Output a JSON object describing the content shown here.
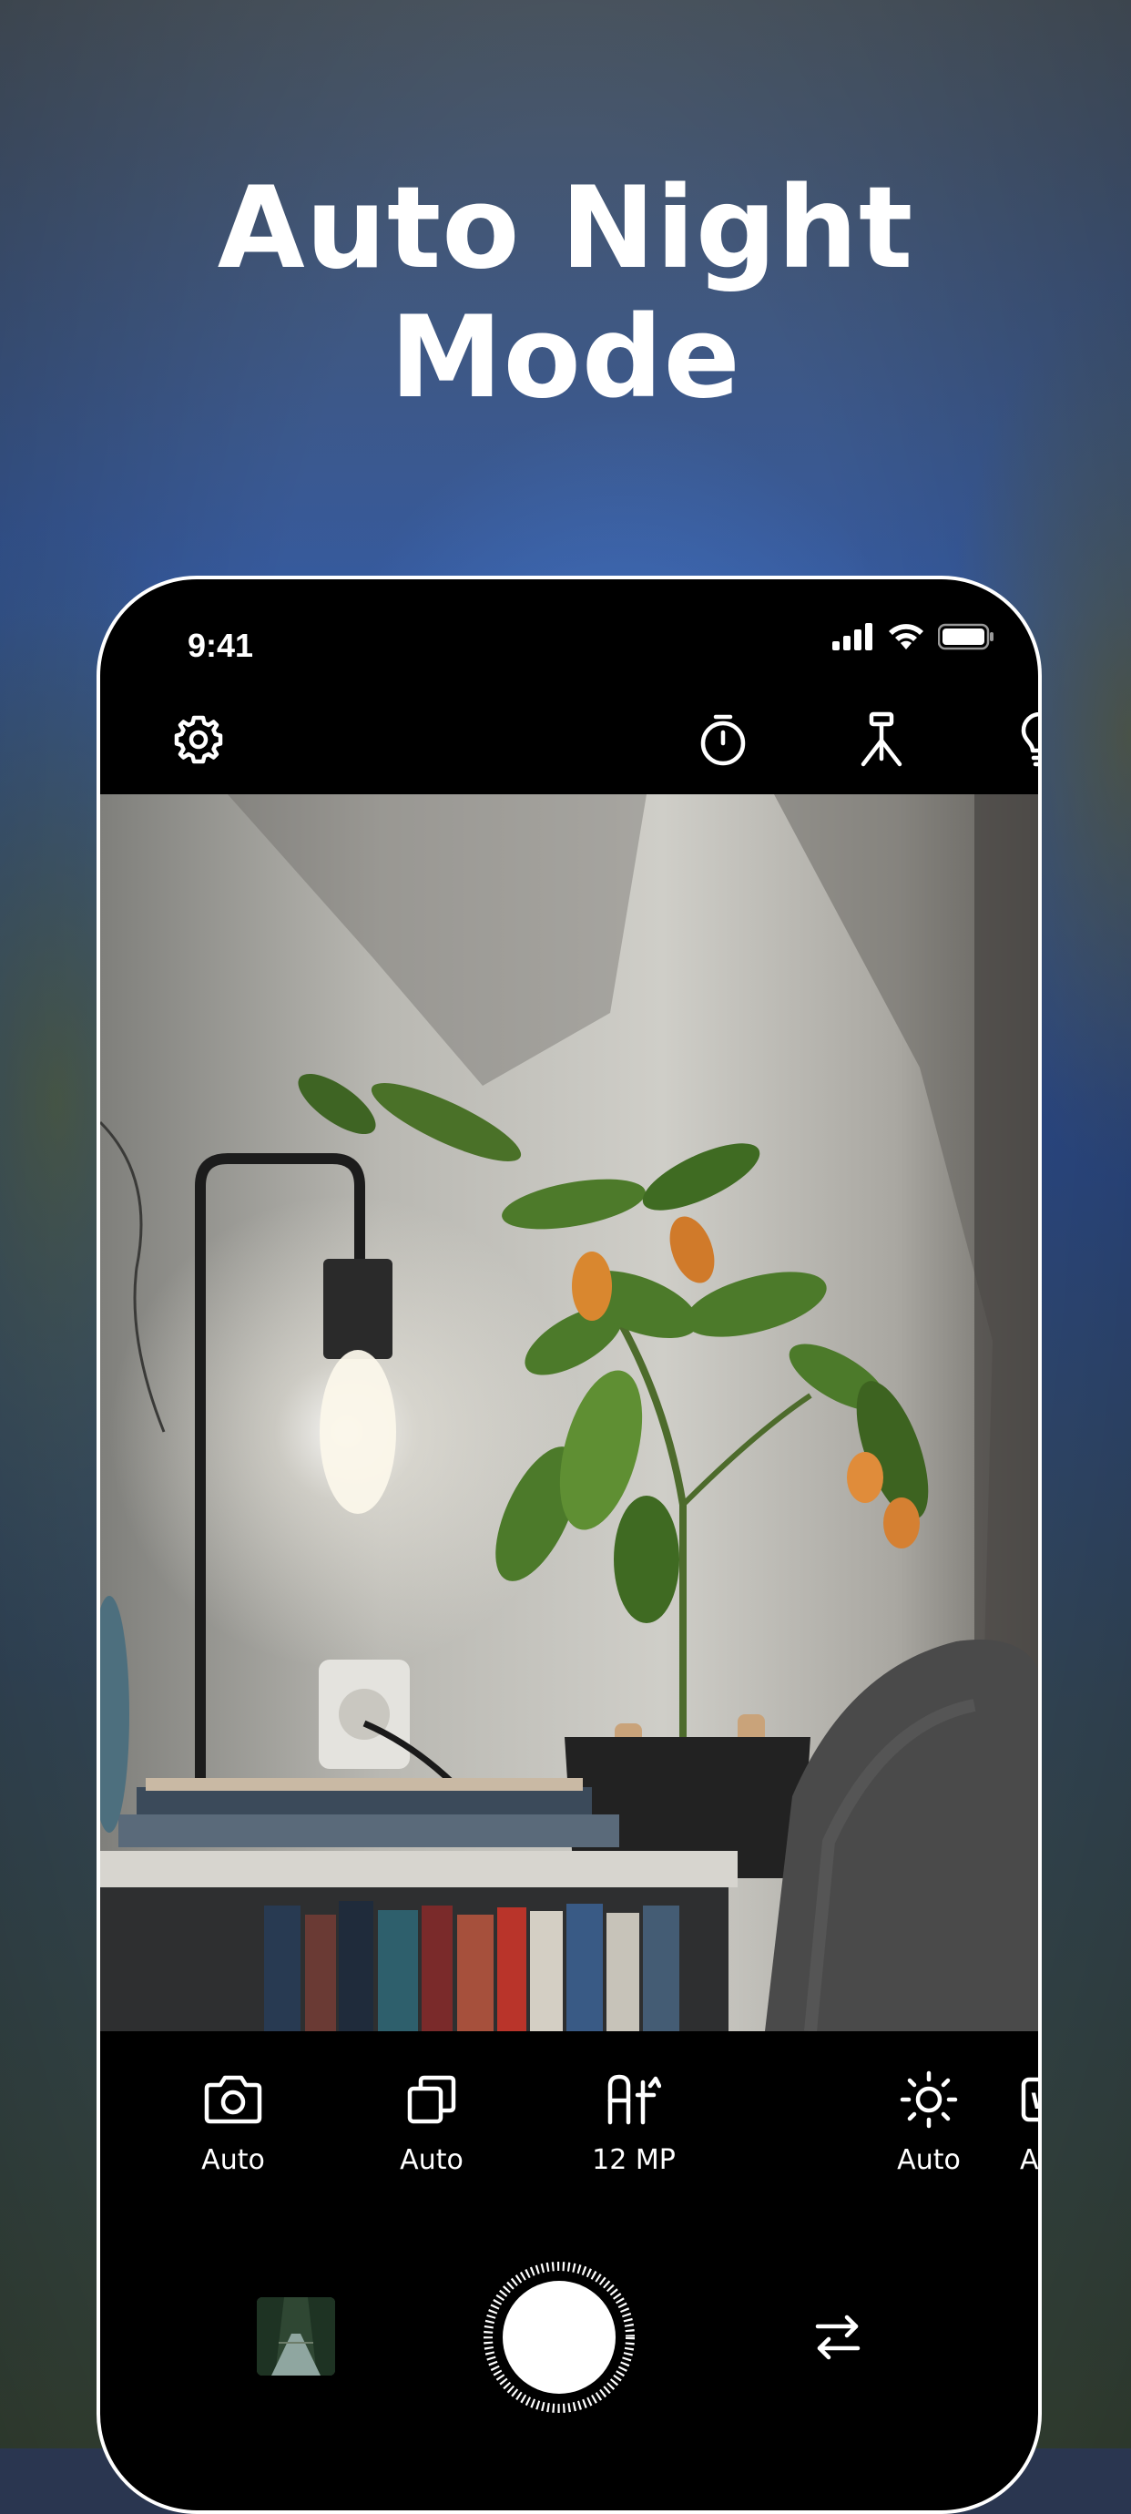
{
  "headline": {
    "line1": "Auto Night",
    "line2": "Mode"
  },
  "status_bar": {
    "time": "9:41",
    "icons": [
      "cellular-signal-icon",
      "wifi-icon",
      "battery-icon"
    ]
  },
  "toolbar": {
    "icons": [
      "settings-gear-icon",
      "timer-icon",
      "tripod-icon",
      "lightbulb-icon"
    ]
  },
  "viewfinder": {
    "scene": "photo-preview"
  },
  "modes": [
    {
      "icon": "camera-icon",
      "label": "Auto"
    },
    {
      "icon": "burst-stack-icon",
      "label": "Auto"
    },
    {
      "icon": "resolution-icon",
      "label": "12 MP"
    },
    {
      "icon": "brightness-sun-icon",
      "label": "Auto"
    },
    {
      "icon": "white-balance-icon",
      "label": "Auto"
    }
  ],
  "capture": {
    "thumbnail": "last-photo-thumbnail",
    "shutter": "shutter-button",
    "flip": "flip-camera-icon"
  },
  "colors": {
    "accent": "#ffffff",
    "ui_background": "#000000"
  }
}
